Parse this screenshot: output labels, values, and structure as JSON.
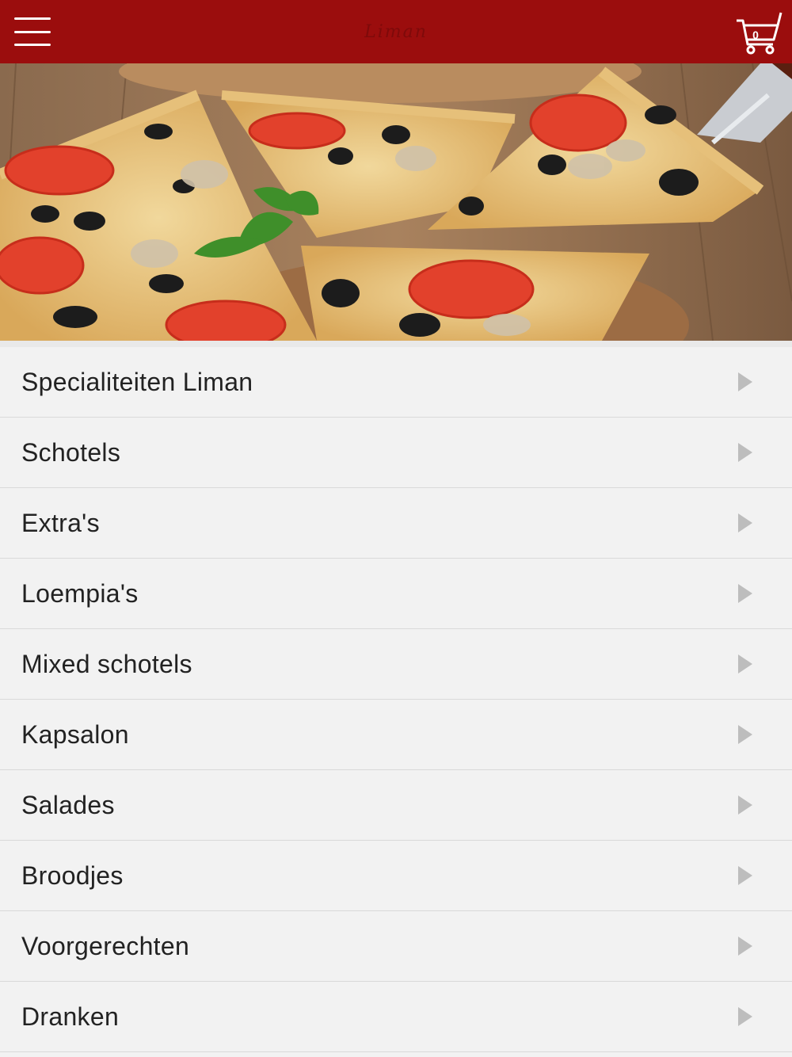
{
  "header": {
    "logo_text": "Liman",
    "cart_count": "0",
    "menu_icon": "hamburger-icon",
    "cart_icon": "shopping-cart-icon",
    "background_color": "#9b0d0d"
  },
  "hero": {
    "image": "pizza-photo"
  },
  "categories": [
    {
      "label": "Specialiteiten Liman"
    },
    {
      "label": "Schotels"
    },
    {
      "label": "Extra's"
    },
    {
      "label": "Loempia's"
    },
    {
      "label": "Mixed schotels"
    },
    {
      "label": "Kapsalon"
    },
    {
      "label": "Salades"
    },
    {
      "label": "Broodjes"
    },
    {
      "label": "Voorgerechten"
    },
    {
      "label": "Dranken"
    }
  ]
}
